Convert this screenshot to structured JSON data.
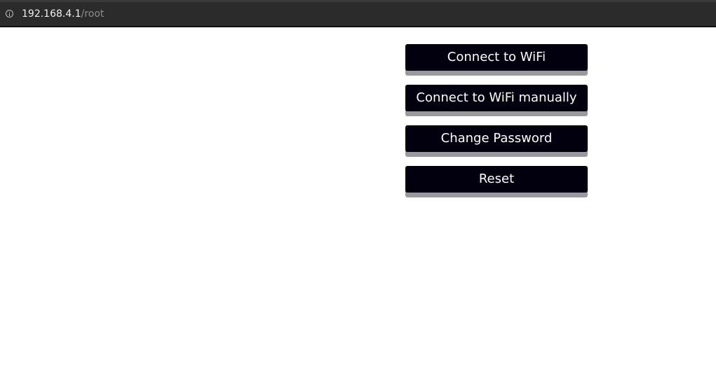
{
  "browser": {
    "url_host": "192.168.4.1",
    "url_path": "/root",
    "icon": "info-icon"
  },
  "menu": {
    "buttons": [
      {
        "label": "Connect to WiFi"
      },
      {
        "label": "Connect to WiFi manually"
      },
      {
        "label": "Change Password"
      },
      {
        "label": "Reset"
      }
    ]
  },
  "colors": {
    "button_background": "#02000f",
    "button_shadow": "#9a9a9a",
    "button_text": "#ffffff",
    "address_bar": "#2b2b2b"
  }
}
